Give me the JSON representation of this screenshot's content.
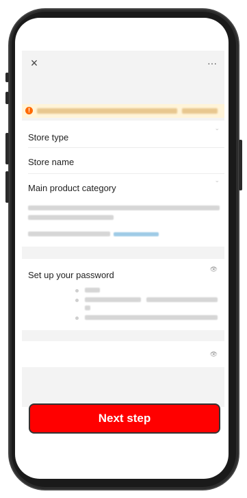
{
  "topbar": {
    "close_icon": "×",
    "more_icon": "···"
  },
  "notice": {
    "icon": "!"
  },
  "form": {
    "store_type_label": "Store type",
    "store_name_label": "Store name",
    "main_category_label": "Main product category",
    "password_label": "Set up your password"
  },
  "icons": {
    "chevron": "⌄",
    "eye": "👁"
  },
  "actions": {
    "next_label": "Next step"
  },
  "colors": {
    "accent": "#ff0000",
    "notice_bg": "#fff4d9",
    "warn": "#ff6a00"
  }
}
